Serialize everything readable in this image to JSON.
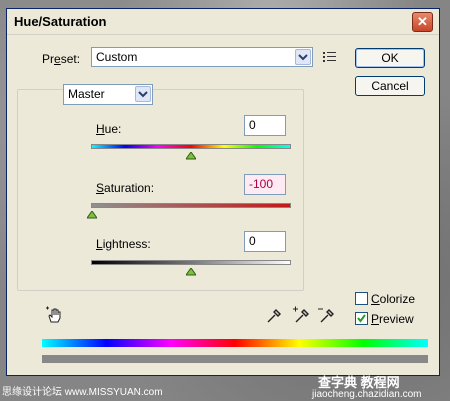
{
  "window": {
    "title": "Hue/Saturation",
    "close_glyph": "✕"
  },
  "preset": {
    "label_pre": "Pr",
    "label_accel": "e",
    "label_post": "set:",
    "value": "Custom",
    "options_icon": "preset-options-icon"
  },
  "buttons": {
    "ok": "OK",
    "cancel": "Cancel"
  },
  "channel": {
    "value": "Master"
  },
  "sliders": {
    "hue": {
      "accel": "H",
      "rest": "ue:",
      "value": "0",
      "position_fraction": 0.5
    },
    "saturation": {
      "accel": "S",
      "rest": "aturation:",
      "value": "-100",
      "position_fraction": 0.0
    },
    "lightness": {
      "accel": "L",
      "rest": "ightness:",
      "value": "0",
      "position_fraction": 0.5
    }
  },
  "options": {
    "colorize": {
      "accel": "C",
      "rest": "olorize",
      "checked": false
    },
    "preview": {
      "accel": "P",
      "rest": "review",
      "checked": true
    }
  },
  "tools": [
    "hand-adjust-icon",
    "eyedropper-icon",
    "eyedropper-plus-icon",
    "eyedropper-minus-icon"
  ],
  "colors": {
    "spectrum": [
      "#00ffff",
      "#0000ff",
      "#ff00ff",
      "#ff0000",
      "#ffff00",
      "#00ff00",
      "#00ffff"
    ],
    "gray": "#888888"
  },
  "watermarks": {
    "left": "思缘设计论坛 www.MISSYUAN.com",
    "right_top": "查字典 教程网",
    "right_bottom": "jiaocheng.chazidian.com"
  }
}
